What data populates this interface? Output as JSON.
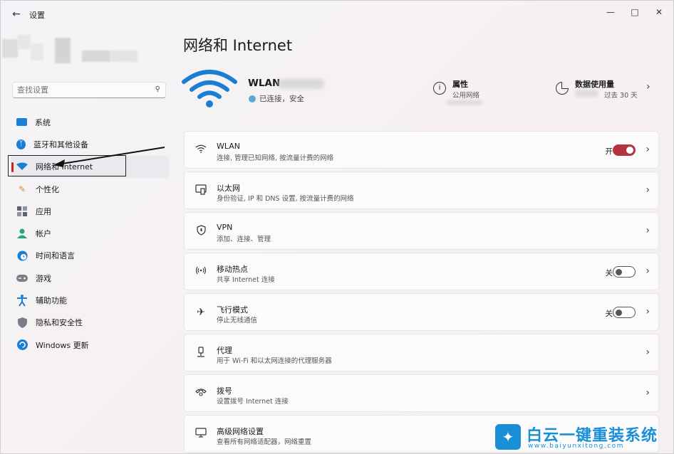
{
  "window": {
    "title": "设置",
    "back_icon": "arrow-left-icon",
    "controls": [
      "minimize",
      "maximize",
      "close"
    ]
  },
  "sidebar": {
    "search_placeholder": "查找设置",
    "items": [
      {
        "label": "系统",
        "icon": "monitor-icon",
        "color": "#1c7fd6"
      },
      {
        "label": "蓝牙和其他设备",
        "icon": "bluetooth-icon",
        "color": "#1c7fd6"
      },
      {
        "label": "网络和 Internet",
        "icon": "wifi-icon",
        "color": "#1c7fd6",
        "active": true
      },
      {
        "label": "个性化",
        "icon": "brush-icon",
        "color": "#d58a3a"
      },
      {
        "label": "应用",
        "icon": "apps-icon",
        "color": "#5b6470"
      },
      {
        "label": "帐户",
        "icon": "person-icon",
        "color": "#22a675"
      },
      {
        "label": "时间和语言",
        "icon": "clock-globe-icon",
        "color": "#1c7fd6"
      },
      {
        "label": "游戏",
        "icon": "gamepad-icon",
        "color": "#7a7f87"
      },
      {
        "label": "辅助功能",
        "icon": "accessibility-icon",
        "color": "#1c7fd6"
      },
      {
        "label": "隐私和安全性",
        "icon": "shield-icon",
        "color": "#7a7f87"
      },
      {
        "label": "Windows 更新",
        "icon": "update-icon",
        "color": "#1c7fd6"
      }
    ]
  },
  "main": {
    "title": "网络和 Internet",
    "network": {
      "name": "WLAN",
      "status": "已连接，安全"
    },
    "properties": {
      "title": "属性",
      "subtitle": "公用网络"
    },
    "data_usage": {
      "title": "数据使用量",
      "subtitle": "过去 30 天"
    },
    "cards": [
      {
        "title": "WLAN",
        "desc": "连接, 管理已知网络, 按流量计费的网络",
        "icon": "wifi-icon",
        "state": "开",
        "toggle": "on"
      },
      {
        "title": "以太网",
        "desc": "身份验证, IP 和 DNS 设置, 按流量计费的网络",
        "icon": "ethernet-icon"
      },
      {
        "title": "VPN",
        "desc": "添加、连接、管理",
        "icon": "shield-icon"
      },
      {
        "title": "移动热点",
        "desc": "共享 Internet 连接",
        "icon": "hotspot-icon",
        "state": "关",
        "toggle": "off"
      },
      {
        "title": "飞行模式",
        "desc": "停止无线通信",
        "icon": "airplane-icon",
        "state": "关",
        "toggle": "off"
      },
      {
        "title": "代理",
        "desc": "用于 Wi-Fi 和以太网连接的代理服务器",
        "icon": "proxy-icon"
      },
      {
        "title": "拨号",
        "desc": "设置拨号 Internet 连接",
        "icon": "dialup-icon"
      },
      {
        "title": "高级网络设置",
        "desc": "查看所有网络适配器，网络重置",
        "icon": "advanced-network-icon"
      }
    ]
  },
  "watermark": {
    "text": "白云一键重装系统",
    "url": "www.baiyunxitong.com",
    "color": "#1a8fd6"
  }
}
